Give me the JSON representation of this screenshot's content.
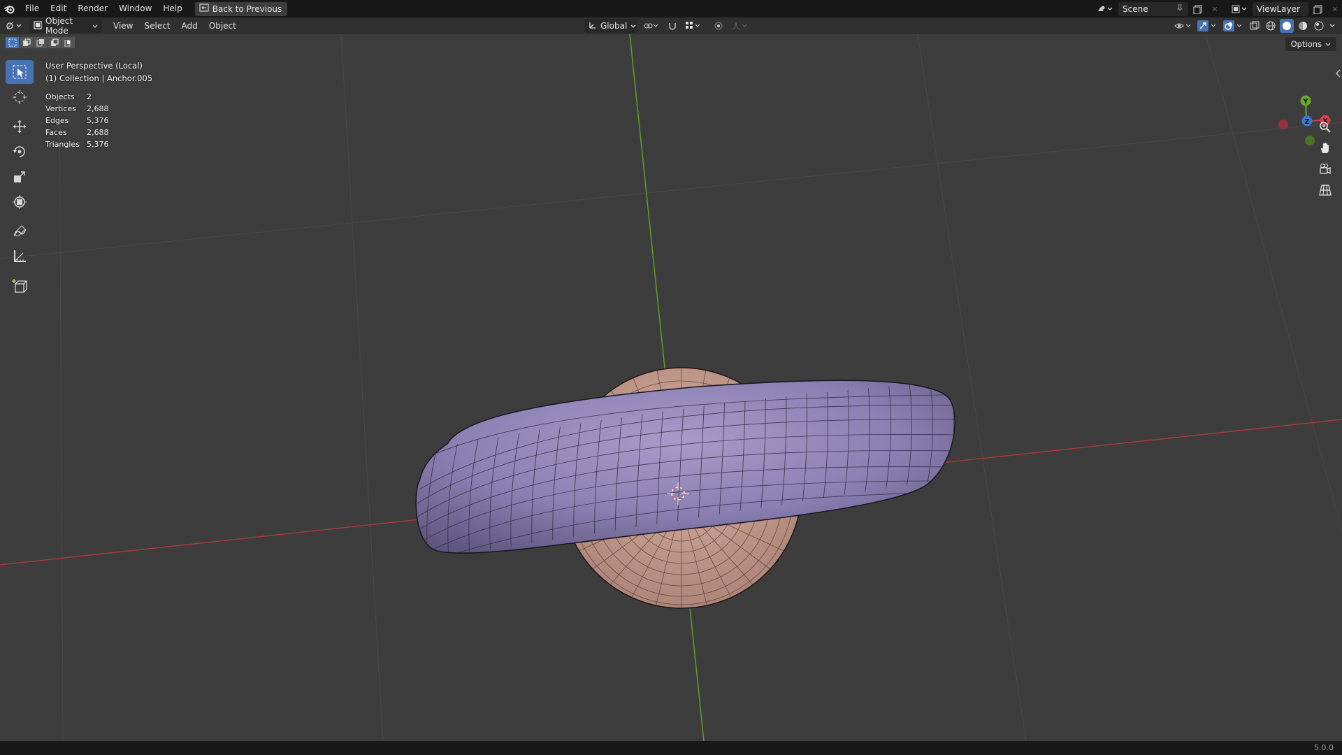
{
  "topbar": {
    "menus": [
      "File",
      "Edit",
      "Render",
      "Window",
      "Help"
    ],
    "back_button": "Back to Previous",
    "scene_name": "Scene",
    "view_layer": "ViewLayer"
  },
  "header": {
    "mode": "Object Mode",
    "menus": [
      "View",
      "Select",
      "Add",
      "Object"
    ],
    "transform_orientation": "Global"
  },
  "viewport": {
    "view_name": "User Perspective (Local)",
    "collection_info": "(1) Collection | Anchor.005",
    "stats": [
      {
        "label": "Objects",
        "value": "2"
      },
      {
        "label": "Vertices",
        "value": "2,688"
      },
      {
        "label": "Edges",
        "value": "5,376"
      },
      {
        "label": "Faces",
        "value": "2,688"
      },
      {
        "label": "Triangles",
        "value": "5,376"
      }
    ],
    "options_label": "Options",
    "gizmo_axes": {
      "x": "X",
      "y": "Y",
      "z": "Z"
    }
  },
  "statusbar": {
    "version": "5.0.0"
  },
  "colors": {
    "torus": "#8c80b4",
    "sphere": "#c89c8c",
    "x_axis": "#a83a3a",
    "y_axis": "#6a9a2a",
    "accent": "#4772b3"
  }
}
